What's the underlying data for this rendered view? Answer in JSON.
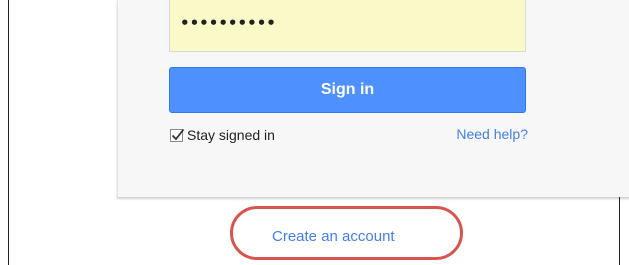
{
  "login": {
    "password_value": "••••••••••",
    "signin_label": "Sign in",
    "stay_signed_in_label": "Stay signed in",
    "stay_signed_in_checked": true,
    "need_help_label": "Need help?"
  },
  "footer": {
    "create_account_label": "Create an account"
  },
  "colors": {
    "accent": "#4d90fe",
    "link": "#427fed",
    "autofill": "#fafac8",
    "highlight": "#d9534f"
  }
}
